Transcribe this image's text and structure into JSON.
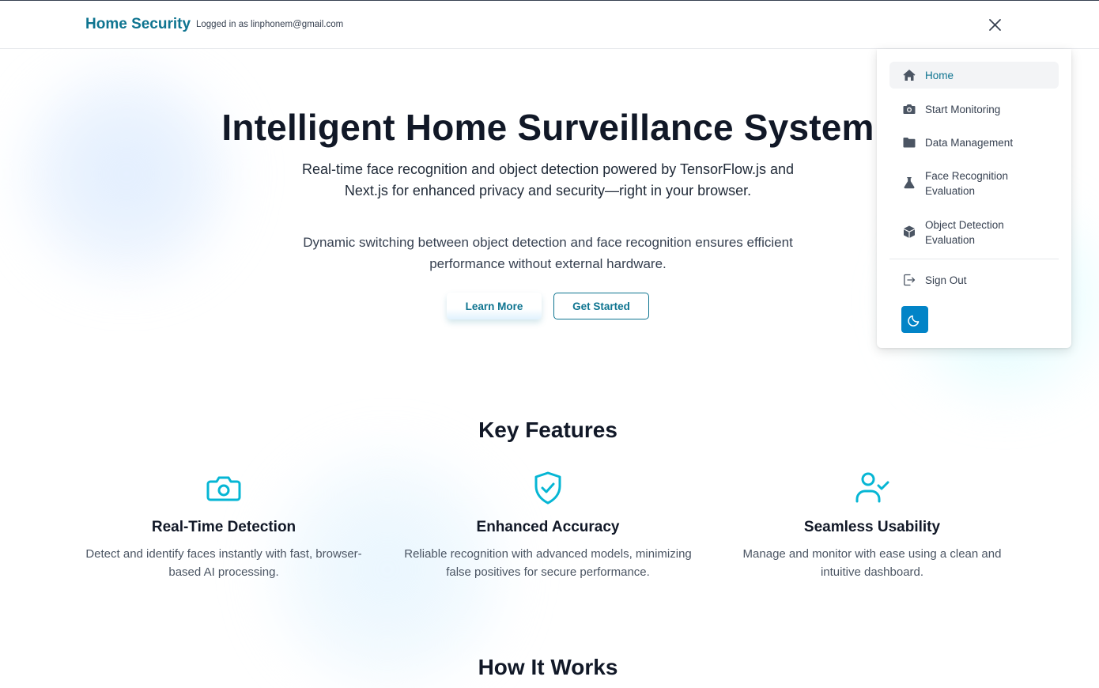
{
  "header": {
    "brand": "Home Security",
    "logged_in_text": "Logged in as linphonem@gmail.com",
    "close_icon": "close-icon"
  },
  "hero": {
    "title": "Intelligent Home Surveillance System",
    "subtitle": "Real-time face recognition and object detection powered by TensorFlow.js and Next.js for enhanced privacy and security—right in your browser.",
    "subtitle2": "Dynamic switching between object detection and face recognition ensures efficient performance without external hardware.",
    "learn_more_label": "Learn More",
    "get_started_label": "Get Started"
  },
  "features": {
    "title": "Key Features",
    "items": [
      {
        "icon": "camera-icon",
        "title": "Real-Time Detection",
        "description": "Detect and identify faces instantly with fast, browser-based AI processing."
      },
      {
        "icon": "shield-check-icon",
        "title": "Enhanced Accuracy",
        "description": "Reliable recognition with advanced models, minimizing false positives for secure performance."
      },
      {
        "icon": "user-check-icon",
        "title": "Seamless Usability",
        "description": "Manage and monitor with ease using a clean and intuitive dashboard."
      }
    ]
  },
  "how_it_works": {
    "title": "How It Works"
  },
  "menu": {
    "items": [
      {
        "icon": "home-icon",
        "label": "Home",
        "active": true
      },
      {
        "icon": "camera-icon",
        "label": "Start Monitoring"
      },
      {
        "icon": "folder-icon",
        "label": "Data Management"
      },
      {
        "icon": "flask-icon",
        "label": "Face Recognition Evaluation"
      },
      {
        "icon": "cube-icon",
        "label": "Object Detection Evaluation"
      }
    ],
    "sign_out": {
      "icon": "sign-out-icon",
      "label": "Sign Out"
    },
    "theme_toggle_icon": "moon-icon"
  },
  "colors": {
    "brand": "#0e7490",
    "accent_icon": "#06b6d4",
    "theme_button": "#0284c7",
    "menu_active_bg": "#f3f4f6"
  }
}
